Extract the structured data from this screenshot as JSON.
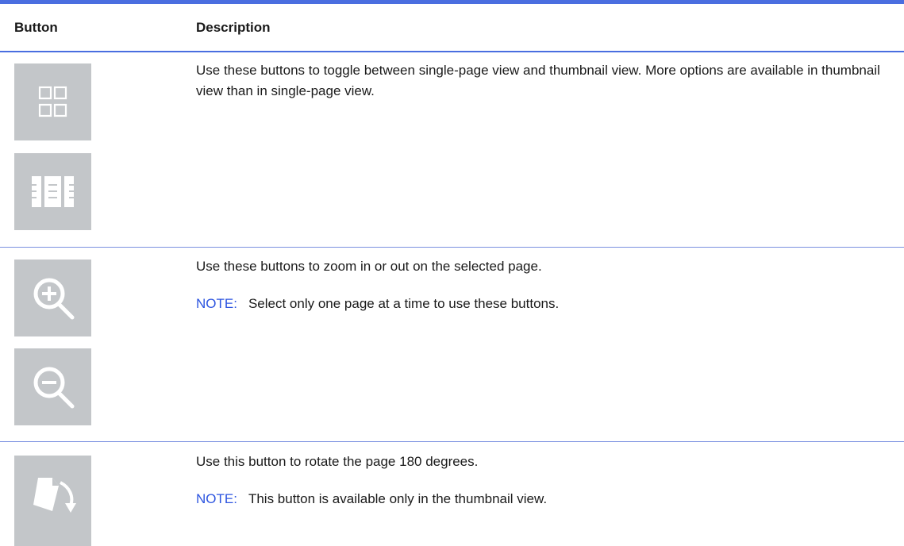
{
  "table": {
    "header": {
      "button": "Button",
      "description": "Description"
    },
    "rows": [
      {
        "buttons": [
          "thumbnail-view-icon",
          "single-page-view-icon"
        ],
        "description": "Use these buttons to toggle between single-page view and thumbnail view. More options are available in thumbnail view than in single-page view.",
        "note_label": "",
        "note_text": ""
      },
      {
        "buttons": [
          "zoom-in-icon",
          "zoom-out-icon"
        ],
        "description": "Use these buttons to zoom in or out on the selected page.",
        "note_label": "NOTE:",
        "note_text": "Select only one page at a time to use these buttons."
      },
      {
        "buttons": [
          "rotate-page-icon"
        ],
        "description": "Use this button to rotate the page 180 degrees.",
        "note_label": "NOTE:",
        "note_text": "This button is available only in the thumbnail view."
      }
    ]
  },
  "colors": {
    "accent": "#4a6ee0",
    "note_label": "#2d55e0",
    "button_bg": "#c3c6c9",
    "icon_fg": "#ffffff"
  }
}
